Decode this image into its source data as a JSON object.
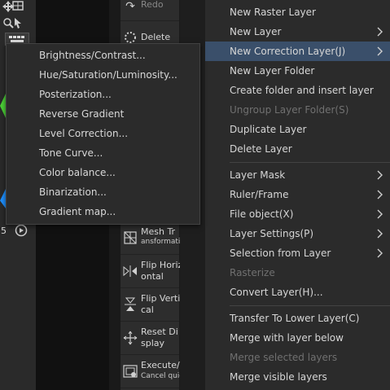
{
  "command_bar": {
    "redo_label": "Redo",
    "delete_label": "Delete",
    "mesh_line1": "Mesh Tr",
    "mesh_line2": "ansformatio",
    "flip_h_line1": "Flip Horiz",
    "flip_h_line2": "ontal",
    "flip_v_line1": "Flip Verti",
    "flip_v_line2": "cal",
    "reset_line1": "Reset Di",
    "reset_line2": "splay",
    "exec_line1": "Execute/",
    "exec_line2": "Cancel quic"
  },
  "toolstrip": {
    "number_label": "5"
  },
  "layer_menu": {
    "items": [
      {
        "label": "New Raster Layer"
      },
      {
        "label": "New Layer"
      },
      {
        "label": "New Correction Layer(J)"
      },
      {
        "label": "New Layer Folder"
      },
      {
        "label": "Create folder and insert layer"
      },
      {
        "label": "Ungroup Layer Folder(S)"
      },
      {
        "label": "Duplicate Layer"
      },
      {
        "label": "Delete Layer"
      },
      {
        "label": "Layer Mask"
      },
      {
        "label": "Ruler/Frame"
      },
      {
        "label": "File object(X)"
      },
      {
        "label": "Layer Settings(P)"
      },
      {
        "label": "Selection from Layer"
      },
      {
        "label": "Rasterize"
      },
      {
        "label": "Convert Layer(H)..."
      },
      {
        "label": "Transfer To Lower Layer(C)"
      },
      {
        "label": "Merge with layer below"
      },
      {
        "label": "Merge selected layers"
      },
      {
        "label": "Merge visible layers"
      }
    ]
  },
  "correction_submenu": {
    "items": [
      {
        "label": "Brightness/Contrast..."
      },
      {
        "label": "Hue/Saturation/Luminosity..."
      },
      {
        "label": "Posterization..."
      },
      {
        "label": "Reverse Gradient"
      },
      {
        "label": "Level Correction..."
      },
      {
        "label": "Tone Curve..."
      },
      {
        "label": "Color balance..."
      },
      {
        "label": "Binarization..."
      },
      {
        "label": "Gradient map..."
      }
    ]
  },
  "colors": {
    "selected_bg": "#3a4f6a",
    "menu_bg": "#2b2b2b",
    "disabled_text": "#707070",
    "accent_green": "#4cd137",
    "accent_blue": "#1e90ff"
  }
}
